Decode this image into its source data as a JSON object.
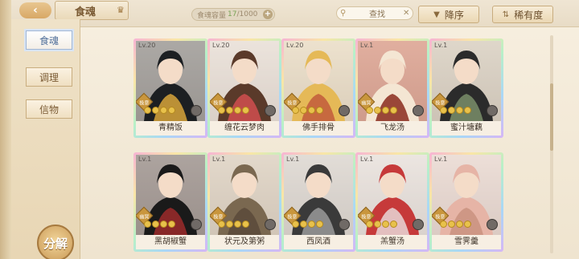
{
  "header": {
    "title": "食魂",
    "capacity_label": "食魂容量",
    "capacity_current": "17",
    "capacity_total": "/1000",
    "plus_label": "+",
    "search_placeholder": "查找",
    "sort_desc_label": "降序",
    "sort_rarity_label": "稀有度"
  },
  "sidebar": {
    "items": [
      {
        "label": "食魂",
        "active": true
      },
      {
        "label": "调理",
        "active": false
      },
      {
        "label": "信物",
        "active": false
      }
    ],
    "decompose_label": "分解"
  },
  "cards": [
    {
      "level": "Lv.20",
      "name": "青精饭",
      "badge": "极意",
      "stars": 4,
      "palette": [
        "#3a3d3f",
        "#1c1f22",
        "#d7a43a"
      ]
    },
    {
      "level": "Lv.20",
      "name": "缠花云梦肉",
      "badge": "极意",
      "stars": 4,
      "palette": [
        "#f0e6dc",
        "#5a3a2a",
        "#d14f4f"
      ]
    },
    {
      "level": "Lv.20",
      "name": "佛手排骨",
      "badge": "极意",
      "stars": 4,
      "palette": [
        "#f3e0b4",
        "#e5b957",
        "#c25b3b"
      ]
    },
    {
      "level": "Lv.1",
      "name": "飞龙汤",
      "badge": "幽冥",
      "stars": 4,
      "palette": [
        "#d14e2e",
        "#f4e6d3",
        "#8a2a1c"
      ]
    },
    {
      "level": "Lv.1",
      "name": "蜜汁塘藕",
      "badge": "极意",
      "stars": 4,
      "palette": [
        "#cbbfa8",
        "#2b2b2b",
        "#7a8e6a"
      ]
    },
    {
      "level": "Lv.1",
      "name": "黑胡椒蟹",
      "badge": "幽冥",
      "stars": 4,
      "palette": [
        "#3b2f2f",
        "#1a1a1a",
        "#9c2c2c"
      ]
    },
    {
      "level": "Lv.1",
      "name": "状元及第粥",
      "badge": "极意",
      "stars": 4,
      "palette": [
        "#d8c7ad",
        "#7a6850",
        "#5b4a3a"
      ]
    },
    {
      "level": "Lv.1",
      "name": "西凤酒",
      "badge": "极意",
      "stars": 4,
      "palette": [
        "#d4d0ce",
        "#3a3a3a",
        "#9a9a9a"
      ]
    },
    {
      "level": "Lv.1",
      "name": "羔蟹汤",
      "badge": "极意",
      "stars": 4,
      "palette": [
        "#f1eaea",
        "#c63a3a",
        "#e8d7d7"
      ]
    },
    {
      "level": "Lv.1",
      "name": "雪霁羹",
      "badge": "极意",
      "stars": 4,
      "palette": [
        "#f3d8d0",
        "#e6b4a6",
        "#c9927f"
      ]
    }
  ]
}
